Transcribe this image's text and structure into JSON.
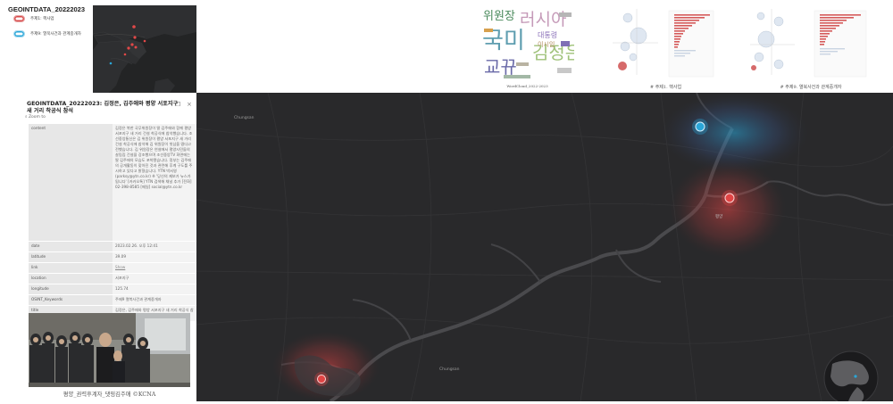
{
  "legend": {
    "title": "GEOINTDATA_20222023",
    "items": [
      {
        "label": "주제1: 핵사업",
        "color": "#d84a4a"
      },
      {
        "label": "주제9: 열북사건과 관계중개자",
        "color": "#2aa6d8"
      }
    ]
  },
  "thumbnails": {
    "wordcloud_caption": "WordCloud_2022-2023",
    "wordcloud_words": [
      "위원장",
      "러시아",
      "국미",
      "김정은",
      "교뀨",
      "대통령",
      "이시임"
    ],
    "topic1_caption": "# 주제1. 핵사업",
    "topic9_caption": "# 주제9. 열북사건과 관계중개자"
  },
  "popup": {
    "title": "GEOINTDATA_20222023: 김정은, 김주애와 평양 서포지구 새 거리 착공식 참석",
    "zoom_label": "Zoom to",
    "rows": [
      {
        "key": "content",
        "value": "김정은 북한 국무위원장이 딸 김주애와 함께 평양 서포지구 새 거리 건설 착공식에 참석했습니다. 조선중앙통신은 김 위원장이 평양 서포지구 새 거리 건설 착공식에 참석해 김 위원장이 첫삽을 떴다고 전했습니다. 김 위원장은 연설에서 평양시민들의 살림집 건설을 강조했으며 조선중앙TV 화면에는 딸 김주애의 모습도 포착됐습니다. 정부는 김주애의 공개활동이 잦아진 것과 관련해 후계 구도를 주시하고 있다고 밝혔습니다. YTN 박서영 (parksy@ytn.co.kr) ※ '당신의 제보가 뉴스가 됩니다' [카카오톡] YTN 검색해 채널 추가 [전화] 02-398-8585 [메일] social@ytn.co.kr"
      },
      {
        "key": "date",
        "value": "2023.02.26. 오후 12:41"
      },
      {
        "key": "latitude",
        "value": "39.09"
      },
      {
        "key": "link",
        "value": "Show"
      },
      {
        "key": "location",
        "value": "서포지구"
      },
      {
        "key": "longitude",
        "value": "125.74"
      },
      {
        "key": "OSINT_Keywords",
        "value": "주제9 열북사건과 관계중개자"
      },
      {
        "key": "title",
        "value": "김정은, 김주애와 평양 서포지구 새 거리 착공식 참석"
      }
    ]
  },
  "photo_caption": "평양_권력후계자_댓핑김주애 ©KCNA",
  "map": {
    "labels": {
      "chungsan_top": "Chungsan",
      "pyongyang": "평양",
      "chungsan_bottom": "Chungsan"
    }
  }
}
